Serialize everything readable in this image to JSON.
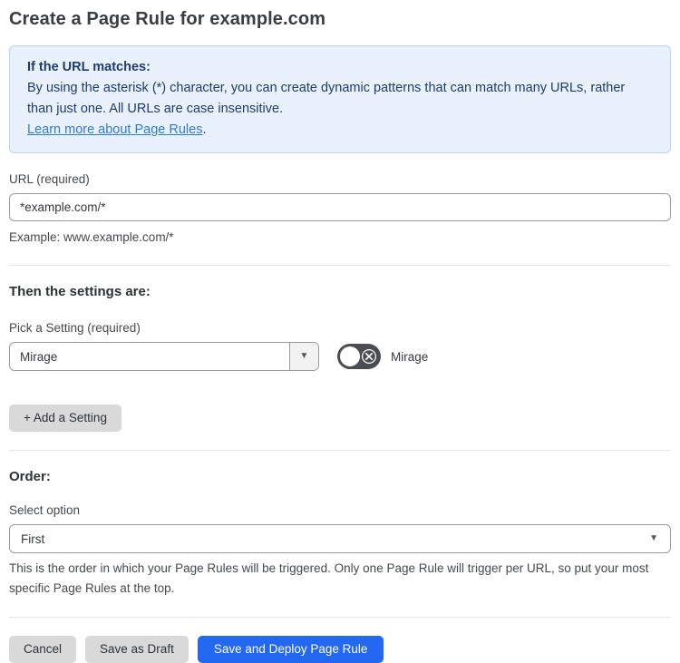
{
  "page": {
    "title": "Create a Page Rule for example.com"
  },
  "info_box": {
    "heading": "If the URL matches:",
    "body": "By using the asterisk (*) character, you can create dynamic patterns that can match many URLs, rather than just one. All URLs are case insensitive.",
    "link_label": "Learn more about Page Rules",
    "link_suffix": "."
  },
  "url_field": {
    "label": "URL (required)",
    "value": "*example.com/*",
    "example": "Example: www.example.com/*"
  },
  "settings_section": {
    "heading": "Then the settings are:",
    "picker_label": "Pick a Setting (required)",
    "selected_setting": "Mirage",
    "toggle": {
      "label": "Mirage",
      "state": "off",
      "icon": "x-circle-icon"
    },
    "add_button_label": "+ Add a Setting"
  },
  "order_section": {
    "heading": "Order:",
    "select_label": "Select option",
    "selected_option": "First",
    "help_text": "This is the order in which your Page Rules will be triggered. Only one Page Rule will trigger per URL, so put your most specific Page Rules at the top."
  },
  "footer": {
    "cancel_label": "Cancel",
    "save_draft_label": "Save as Draft",
    "save_deploy_label": "Save and Deploy Page Rule"
  },
  "icons": {
    "caret_down": "▼"
  },
  "colors": {
    "info_bg": "#e8f1fc",
    "info_border": "#b9d5f5",
    "info_text": "#1e3c6e",
    "link_blue": "#2f7bd9",
    "primary_blue": "#2368f0",
    "button_gray": "#d9d9d9",
    "toggle_dark": "#4a4d52",
    "divider": "#e4e4e4"
  }
}
